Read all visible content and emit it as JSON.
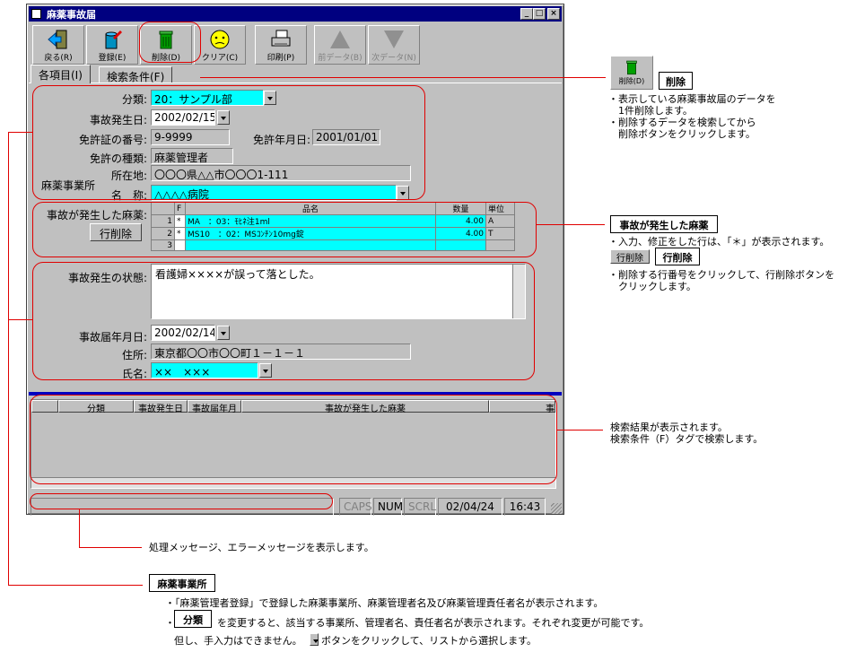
{
  "window": {
    "title": "麻薬事故届",
    "controls": [
      "_",
      "□",
      "×"
    ]
  },
  "toolbar": [
    {
      "label": "戻る(R)",
      "icon": "door-exit-icon",
      "enabled": true
    },
    {
      "label": "登録(E)",
      "icon": "register-can-icon",
      "enabled": true
    },
    {
      "label": "削除(D)",
      "icon": "trash-can-icon",
      "enabled": true
    },
    {
      "label": "クリア(C)",
      "icon": "face-icon",
      "enabled": true
    },
    {
      "label": "印刷(P)",
      "icon": "printer-icon",
      "enabled": true
    },
    {
      "label": "前データ(B)",
      "icon": "up-arrow-icon",
      "enabled": false
    },
    {
      "label": "次データ(N)",
      "icon": "down-arrow-icon",
      "enabled": false
    }
  ],
  "tabs": [
    "各項目(I)",
    "検索条件(F)"
  ],
  "form": {
    "category_label": "分類:",
    "category_value": "20：サンプル部",
    "date_label": "事故発生日:",
    "date_value": "2002/02/15",
    "license_label": "免許証の番号:",
    "license_value": "9-9999",
    "license_date_label": "免許年月日:",
    "license_date_value": "2001/01/01",
    "license_type_label": "免許の種類:",
    "license_type_value": "麻薬管理者",
    "office_label": "麻薬事業所",
    "address_label": "所在地:",
    "address_value": "〇〇〇県△△市〇〇〇1-111",
    "name_label": "名　称:",
    "name_value": "△△△△病院",
    "drug_label": "事故が発生した麻薬:",
    "row_delete": "行削除",
    "drug_headers": [
      "",
      "F",
      "品名",
      "数量",
      "単位"
    ],
    "drug_rows": [
      {
        "no": "1",
        "f": "*",
        "name": "MA　：03：ﾓﾋﾈ注1ml",
        "qty": "4.00",
        "unit": "A"
      },
      {
        "no": "2",
        "f": "*",
        "name": "MS10　：02：MSｺﾝﾁﾝ10mg錠",
        "qty": "4.00",
        "unit": "T"
      },
      {
        "no": "3",
        "f": "",
        "name": "",
        "qty": "",
        "unit": ""
      }
    ],
    "state_label": "事故発生の状態:",
    "state_value": "看護婦××××が誤って落とした。",
    "report_date_label": "事故届年月日:",
    "report_date_value": "2002/02/14",
    "reporter_addr_label": "住所:",
    "reporter_addr_value": "東京都〇〇市〇〇町１－１－１",
    "reporter_name_label": "氏名:",
    "reporter_name_value": "××　×××"
  },
  "results": {
    "headers": [
      "分類",
      "事故発生日",
      "事故届年月",
      "事故が発生した麻薬",
      "事"
    ]
  },
  "status": {
    "caps": "CAPS",
    "num": "NUM",
    "scrl": "SCRL",
    "date": "02/04/24",
    "time": "16:43"
  },
  "notes": {
    "delete_btn_caption": "削除(D)",
    "delete_title": "削除",
    "delete_lines": [
      "・表示している麻薬事故届のデータを",
      "　1件削除します。",
      "・削除するデータを検索してから",
      "　削除ボタンをクリックします。"
    ],
    "drug_title": "事故が発生した麻薬",
    "drug_line1": "・入力、修正をした行は、「＊」が表示されます。",
    "row_delete_small": "行削除",
    "row_delete_title": "行削除",
    "drug_lines2": [
      "・削除する行番号をクリックして、行削除ボタンを",
      "　クリックします。"
    ],
    "search_lines": [
      "検索結果が表示されます。",
      "検索条件（F）タグで検索します。"
    ],
    "message_line": "処理メッセージ、エラーメッセージを表示します。",
    "office_title": "麻薬事業所",
    "office_line1": "・「麻薬管理者登録」で登録した麻薬事業所、麻薬管理者名及び麻薬管理責任者名が表示されます。",
    "category_btn": "分類",
    "office_line2": "を変更すると、該当する事業所、管理者名、責任者名が表示されます。それぞれ変更が可能です。",
    "office_line3a": "但し、手入力はできません。",
    "office_line3b": "ボタンをクリックして、リストから選択します。"
  }
}
